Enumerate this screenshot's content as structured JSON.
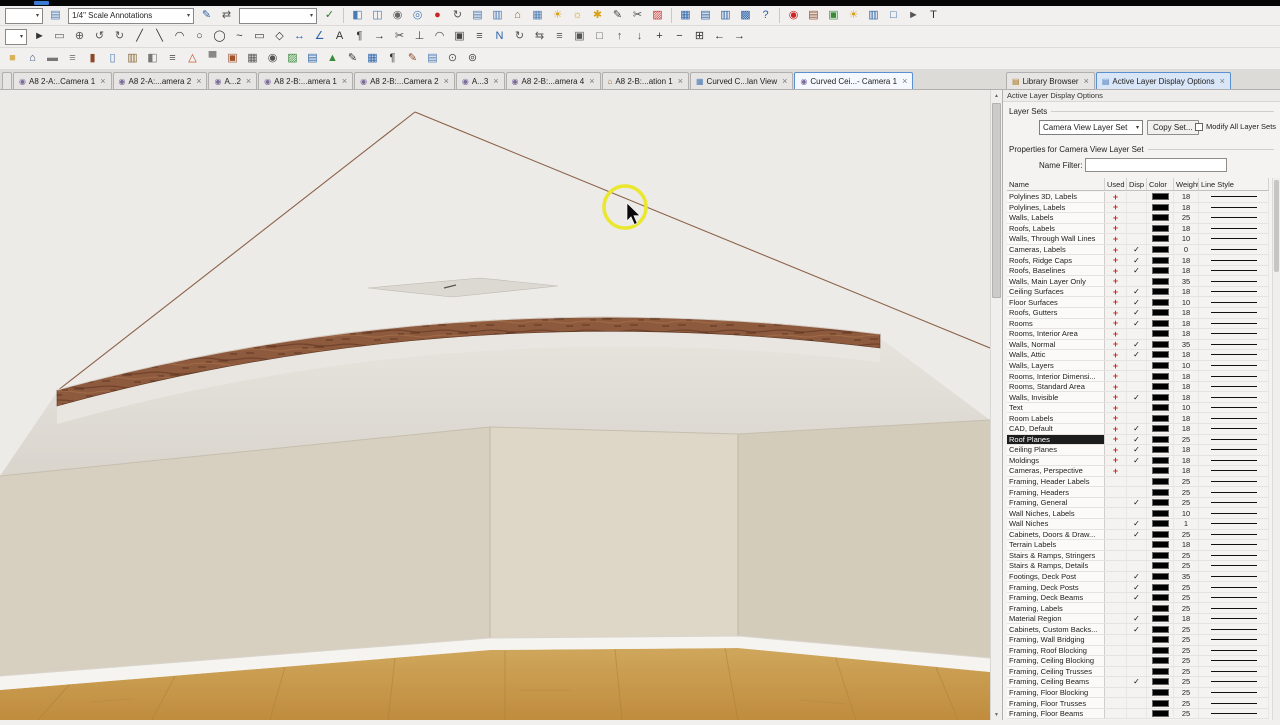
{
  "ui": {
    "close_glyph": "×",
    "combo_arrow": "▾",
    "check_glyph": "✓",
    "used_glyph": "+",
    "scroll_up": "▲",
    "scroll_down": "▼",
    "accent_chip": "#3a7bd5"
  },
  "toolbar_left": {
    "mini_combo": "",
    "scale_combo": "1/4\" Scale Annotations",
    "wide_combo": ""
  },
  "toolbar1pre1": [
    {
      "n": "layer-set-icon",
      "g": "▤",
      "c": "#4a7ab5"
    }
  ],
  "toolbar1pre2": [
    {
      "n": "annotation-pen-icon",
      "g": "✎",
      "c": "#2a62a8"
    },
    {
      "n": "swap-annotations-icon",
      "g": "⇄",
      "c": "#555555"
    }
  ],
  "toolbar1pre3": [
    {
      "n": "apply-check-icon",
      "g": "✓",
      "c": "#2a7a2a"
    }
  ],
  "toolbar1a": [
    {
      "n": "cube-3d-icon",
      "g": "◧",
      "c": "#4a7ab5"
    },
    {
      "n": "cube-faces-icon",
      "g": "◫",
      "c": "#4a7ab5"
    },
    {
      "n": "camera-view-icon",
      "g": "◉",
      "c": "#666666"
    },
    {
      "n": "orbit-view-icon",
      "g": "◎",
      "c": "#4a7ab5"
    },
    {
      "n": "record-walkthrough-icon",
      "g": "●",
      "c": "#cc2525"
    },
    {
      "n": "walkthrough-path-icon",
      "g": "↻",
      "c": "#555555"
    },
    {
      "n": "elevation-view-icon",
      "g": "▤",
      "c": "#4a7ab5"
    },
    {
      "n": "cross-section-icon",
      "g": "▥",
      "c": "#4a7ab5"
    },
    {
      "n": "backdrop-icon",
      "g": "⌂",
      "c": "#8a5a35"
    },
    {
      "n": "framing-overview-icon",
      "g": "▦",
      "c": "#4a7ab5"
    },
    {
      "n": "sun-settings-icon",
      "g": "☀",
      "c": "#d9a012"
    },
    {
      "n": "light-toggle-icon",
      "g": "☼",
      "c": "#d9a012"
    },
    {
      "n": "adjust-lights-icon",
      "g": "✱",
      "c": "#d9a012"
    },
    {
      "n": "edit-surface-icon",
      "g": "✎",
      "c": "#444444"
    },
    {
      "n": "delete-surface-icon",
      "g": "✂",
      "c": "#444444"
    },
    {
      "n": "hatch-fill-icon",
      "g": "▨",
      "c": "#cc3333"
    }
  ],
  "toolbar1b": [
    {
      "n": "layout-page-icon",
      "g": "▦",
      "c": "#2a62a8"
    },
    {
      "n": "layout-box-icon",
      "g": "▤",
      "c": "#2a62a8"
    },
    {
      "n": "schedule-table-icon",
      "g": "▥",
      "c": "#2a62a8"
    },
    {
      "n": "materials-list-icon",
      "g": "▩",
      "c": "#2a62a8"
    },
    {
      "n": "help-icon",
      "g": "?",
      "c": "#2a62a8"
    }
  ],
  "toolbar1c": [
    {
      "n": "render-camera-icon",
      "g": "◉",
      "c": "#cc2525"
    },
    {
      "n": "building-tools-icon",
      "g": "▤",
      "c": "#8a4a2a"
    },
    {
      "n": "picture-import-icon",
      "g": "▣",
      "c": "#3a8a3a"
    },
    {
      "n": "sun-angle-icon",
      "g": "☀",
      "c": "#d9a012"
    },
    {
      "n": "column-tool-icon",
      "g": "▥",
      "c": "#2a62a8"
    },
    {
      "n": "cad-detail-icon",
      "g": "□",
      "c": "#2a62a8"
    },
    {
      "n": "select-pointer-icon",
      "g": "►",
      "c": "#555555"
    },
    {
      "n": "text-tool-icon",
      "g": "T",
      "c": "#333333"
    }
  ],
  "toolbar2": [
    {
      "n": "select-arrow-icon",
      "g": "►",
      "c": "#333333"
    },
    {
      "n": "marquee-select-icon",
      "g": "▭",
      "c": "#555555"
    },
    {
      "n": "pan-icon",
      "g": "⊕",
      "c": "#555555"
    },
    {
      "n": "undo-icon",
      "g": "↺",
      "c": "#555555"
    },
    {
      "n": "redo-icon",
      "g": "↻",
      "c": "#555555"
    },
    {
      "n": "line-tool-icon",
      "g": "╱",
      "c": "#333333"
    },
    {
      "n": "polyline-tool-icon",
      "g": "╲",
      "c": "#333333"
    },
    {
      "n": "arc-tool-icon",
      "g": "◠",
      "c": "#333333"
    },
    {
      "n": "circle-tool-icon",
      "g": "○",
      "c": "#333333"
    },
    {
      "n": "oval-tool-icon",
      "g": "◯",
      "c": "#333333"
    },
    {
      "n": "spline-tool-icon",
      "g": "~",
      "c": "#333333"
    },
    {
      "n": "rectangle-tool-icon",
      "g": "▭",
      "c": "#333333"
    },
    {
      "n": "polygon-tool-icon",
      "g": "◇",
      "c": "#333333"
    },
    {
      "n": "dimension-tool-icon",
      "g": "↔",
      "c": "#2a62a8"
    },
    {
      "n": "angle-dimension-icon",
      "g": "∠",
      "c": "#2a62a8"
    },
    {
      "n": "text-icon",
      "g": "A",
      "c": "#333333"
    },
    {
      "n": "callout-icon",
      "g": "¶",
      "c": "#333333"
    },
    {
      "n": "arrow-tool-icon",
      "g": "→",
      "c": "#333333"
    },
    {
      "n": "break-tool-icon",
      "g": "✂",
      "c": "#444444"
    },
    {
      "n": "trim-tool-icon",
      "g": "⊥",
      "c": "#444444"
    },
    {
      "n": "fillet-tool-icon",
      "g": "◠",
      "c": "#444444"
    },
    {
      "n": "copy-icon",
      "g": "▣",
      "c": "#444444"
    },
    {
      "n": "measure-icon",
      "g": "≡",
      "c": "#444444"
    },
    {
      "n": "north-pointer-icon",
      "g": "N",
      "c": "#2a62a8"
    },
    {
      "n": "rotate-icon",
      "g": "↻",
      "c": "#555555"
    },
    {
      "n": "mirror-icon",
      "g": "⇆",
      "c": "#555555"
    },
    {
      "n": "align-icon",
      "g": "≡",
      "c": "#555555"
    },
    {
      "n": "group-icon",
      "g": "▣",
      "c": "#555555"
    },
    {
      "n": "ungroup-icon",
      "g": "□",
      "c": "#555555"
    },
    {
      "n": "raise-icon",
      "g": "↑",
      "c": "#555555"
    },
    {
      "n": "lower-icon",
      "g": "↓",
      "c": "#555555"
    },
    {
      "n": "zoom-in-icon",
      "g": "+",
      "c": "#333333"
    },
    {
      "n": "zoom-out-icon",
      "g": "−",
      "c": "#333333"
    },
    {
      "n": "fit-view-icon",
      "g": "⊞",
      "c": "#333333"
    },
    {
      "n": "previous-view-icon",
      "g": "←",
      "c": "#333333"
    },
    {
      "n": "next-view-icon",
      "g": "→",
      "c": "#333333"
    }
  ],
  "toolbar3": [
    {
      "n": "open-plan-icon",
      "g": "■",
      "c": "#d8b25a"
    },
    {
      "n": "home-icon",
      "g": "⌂",
      "c": "#35557a"
    },
    {
      "n": "wall-tool-icon",
      "g": "▬",
      "c": "#777777"
    },
    {
      "n": "railing-tool-icon",
      "g": "≡",
      "c": "#777777"
    },
    {
      "n": "door-tool-icon",
      "g": "▮",
      "c": "#8a4a2a"
    },
    {
      "n": "window-tool-icon",
      "g": "▯",
      "c": "#4a7ab5"
    },
    {
      "n": "cabinet-tool-icon",
      "g": "▥",
      "c": "#8a6a3a"
    },
    {
      "n": "fixture-tool-icon",
      "g": "◧",
      "c": "#777777"
    },
    {
      "n": "stairs-tool-icon",
      "g": "≡",
      "c": "#555555"
    },
    {
      "n": "roof-tool-icon",
      "g": "△",
      "c": "#c24a22"
    },
    {
      "n": "ceiling-tool-icon",
      "g": "▀",
      "c": "#888888"
    },
    {
      "n": "fireplace-tool-icon",
      "g": "▣",
      "c": "#a0522d"
    },
    {
      "n": "print-icon",
      "g": "▦",
      "c": "#555555"
    },
    {
      "n": "preview-icon",
      "g": "◉",
      "c": "#555555"
    },
    {
      "n": "material-painter-icon",
      "g": "▨",
      "c": "#3a8a3a"
    },
    {
      "n": "library-icon",
      "g": "▤",
      "c": "#2a62a8"
    },
    {
      "n": "terrain-icon",
      "g": "▲",
      "c": "#3a8a3a"
    },
    {
      "n": "cad-tools-icon",
      "g": "✎",
      "c": "#333333"
    },
    {
      "n": "schedule-icon",
      "g": "▦",
      "c": "#2a62a8"
    },
    {
      "n": "note-icon",
      "g": "¶",
      "c": "#333333"
    },
    {
      "n": "revision-icon",
      "g": "✎",
      "c": "#8a4a2a"
    },
    {
      "n": "layers-icon",
      "g": "▤",
      "c": "#4a7ab5"
    },
    {
      "n": "settings-icon",
      "g": "⊙",
      "c": "#555555"
    },
    {
      "n": "defaults-icon",
      "g": "⊚",
      "c": "#555555"
    }
  ],
  "doc_tabs": [
    {
      "label": "",
      "g": "",
      "gc": "#777777",
      "n": "tab-partial",
      "partial": true
    },
    {
      "label": "A8 2-A:..Camera 1",
      "g": "◉",
      "gc": "#7a6a9a",
      "n": "tab-a8-2a-camera-1"
    },
    {
      "label": "A8 2-A:...amera 2",
      "g": "◉",
      "gc": "#7a6a9a",
      "n": "tab-a8-2a-camera-2"
    },
    {
      "label": "A...2",
      "g": "◉",
      "gc": "#7a6a9a",
      "n": "tab-a-2"
    },
    {
      "label": "A8 2-B:...amera 1",
      "g": "◉",
      "gc": "#7a6a9a",
      "n": "tab-a8-2b-camera-1"
    },
    {
      "label": "A8 2-B:...Camera 2",
      "g": "◉",
      "gc": "#7a6a9a",
      "n": "tab-a8-2b-camera-2"
    },
    {
      "label": "A...3",
      "g": "◉",
      "gc": "#7a6a9a",
      "n": "tab-a-3"
    },
    {
      "label": "A8 2-B:...amera 4",
      "g": "◉",
      "gc": "#7a6a9a",
      "n": "tab-a8-2b-camera-4"
    },
    {
      "label": "A8 2-B:...ation 1",
      "g": "⌂",
      "gc": "#8a6a3a",
      "n": "tab-a8-2b-elevation-1"
    },
    {
      "label": "Curved C...lan View",
      "g": "▦",
      "gc": "#4a7ab5",
      "n": "tab-curved-ceiling-plan-view"
    },
    {
      "label": "Curved Cei...- Camera 1",
      "g": "◉",
      "gc": "#7a6a9a",
      "active": true,
      "n": "tab-curved-ceiling-camera-1"
    }
  ],
  "panel_tabs": [
    {
      "label": "Library Browser",
      "g": "▤",
      "gc": "#a8781e",
      "n": "tab-library-browser"
    },
    {
      "label": "Active Layer Display Options",
      "g": "▤",
      "gc": "#4a7ab5",
      "active": true,
      "n": "tab-active-layer-display-options"
    }
  ],
  "viewport": {
    "colors": {
      "ceiling": "#edebe7",
      "vault_top": "#e8e5e0",
      "vault_bottom": "#d9d5cd",
      "wall_left": "#d7cfbf",
      "wall_back": "#ded7c7",
      "wall_right": "#d3ccbb",
      "baseboard": "#f6f4f0",
      "floor_top": "#cfa75c",
      "floor_bottom": "#c08c3e",
      "beam_wood": "#8d5a3e",
      "ridge_line": "#8a6148",
      "highlight_ring": "#e9e72e"
    }
  },
  "panel": {
    "title": "Active Layer Display Options",
    "layer_sets_label": "Layer Sets",
    "layer_set_value": "Camera View Layer Set",
    "copy_set_button": "Copy Set...",
    "modify_all_label": "Modify All Layer Sets",
    "properties_label": "Properties for Camera View Layer Set",
    "name_filter_label": "Name Filter:",
    "name_filter_value": "",
    "columns": [
      "Name",
      "Used",
      "Disp",
      "Color",
      "Weight",
      "Line Style"
    ],
    "rows": [
      {
        "name": "Polylines 3D, Labels",
        "used": true,
        "disp": false,
        "weight": "18"
      },
      {
        "name": "Polylines, Labels",
        "used": true,
        "disp": false,
        "weight": "18"
      },
      {
        "name": "Walls, Labels",
        "used": true,
        "disp": false,
        "weight": "25"
      },
      {
        "name": "Roofs, Labels",
        "used": true,
        "disp": false,
        "weight": "18"
      },
      {
        "name": "Walls, Through Wall Lines",
        "used": true,
        "disp": false,
        "weight": "10"
      },
      {
        "name": "Cameras, Labels",
        "used": true,
        "disp": true,
        "weight": "0"
      },
      {
        "name": "Roofs, Ridge Caps",
        "used": true,
        "disp": true,
        "weight": "18"
      },
      {
        "name": "Roofs, Baselines",
        "used": true,
        "disp": true,
        "weight": "18"
      },
      {
        "name": "Walls, Main Layer Only",
        "used": true,
        "disp": false,
        "weight": "35"
      },
      {
        "name": "Ceiling Surfaces",
        "used": true,
        "disp": true,
        "weight": "18"
      },
      {
        "name": "Floor Surfaces",
        "used": true,
        "disp": true,
        "weight": "10"
      },
      {
        "name": "Roofs, Gutters",
        "used": true,
        "disp": true,
        "weight": "18"
      },
      {
        "name": "Rooms",
        "used": true,
        "disp": true,
        "weight": "18"
      },
      {
        "name": "Rooms, Interior Area",
        "used": true,
        "disp": false,
        "weight": "18"
      },
      {
        "name": "Walls, Normal",
        "used": true,
        "disp": true,
        "weight": "35"
      },
      {
        "name": "Walls, Attic",
        "used": true,
        "disp": true,
        "weight": "18"
      },
      {
        "name": "Walls, Layers",
        "used": true,
        "disp": false,
        "weight": "10"
      },
      {
        "name": "Rooms, Interior Dimensi...",
        "used": true,
        "disp": false,
        "weight": "18"
      },
      {
        "name": "Rooms, Standard Area",
        "used": true,
        "disp": false,
        "weight": "18"
      },
      {
        "name": "Walls, Invisible",
        "used": true,
        "disp": true,
        "weight": "18"
      },
      {
        "name": "Text",
        "used": true,
        "disp": false,
        "weight": "10"
      },
      {
        "name": "Room Labels",
        "used": true,
        "disp": false,
        "weight": "18"
      },
      {
        "name": "CAD, Default",
        "used": true,
        "disp": true,
        "weight": "18"
      },
      {
        "name": "Roof Planes",
        "used": true,
        "disp": true,
        "weight": "25",
        "selected": true
      },
      {
        "name": "Ceiling Planes",
        "used": true,
        "disp": true,
        "weight": "18"
      },
      {
        "name": "Moldings",
        "used": true,
        "disp": true,
        "weight": "18"
      },
      {
        "name": "Cameras, Perspective",
        "used": true,
        "disp": false,
        "weight": "18"
      },
      {
        "name": "Framing, Header Labels",
        "used": false,
        "disp": false,
        "weight": "25"
      },
      {
        "name": "Framing, Headers",
        "used": false,
        "disp": false,
        "weight": "25"
      },
      {
        "name": "Framing, General",
        "used": false,
        "disp": true,
        "weight": "25"
      },
      {
        "name": "Wall Niches, Labels",
        "used": false,
        "disp": false,
        "weight": "10"
      },
      {
        "name": "Wall Niches",
        "used": false,
        "disp": true,
        "weight": "1"
      },
      {
        "name": "Cabinets, Doors & Draw...",
        "used": false,
        "disp": true,
        "weight": "25"
      },
      {
        "name": "Terrain Labels",
        "used": false,
        "disp": false,
        "weight": "18"
      },
      {
        "name": "Stairs & Ramps, Stringers",
        "used": false,
        "disp": false,
        "weight": "25"
      },
      {
        "name": "Stairs & Ramps, Details",
        "used": false,
        "disp": false,
        "weight": "25"
      },
      {
        "name": "Footings, Deck Post",
        "used": false,
        "disp": true,
        "weight": "35"
      },
      {
        "name": "Framing, Deck Posts",
        "used": false,
        "disp": true,
        "weight": "25"
      },
      {
        "name": "Framing, Deck Beams",
        "used": false,
        "disp": true,
        "weight": "25"
      },
      {
        "name": "Framing, Labels",
        "used": false,
        "disp": false,
        "weight": "25"
      },
      {
        "name": "Material Region",
        "used": false,
        "disp": true,
        "weight": "18"
      },
      {
        "name": "Cabinets, Custom Backs...",
        "used": false,
        "disp": true,
        "weight": "25"
      },
      {
        "name": "Framing, Wall Bridging",
        "used": false,
        "disp": false,
        "weight": "25"
      },
      {
        "name": "Framing, Roof Blocking",
        "used": false,
        "disp": false,
        "weight": "25"
      },
      {
        "name": "Framing, Ceiling Blocking",
        "used": false,
        "disp": false,
        "weight": "25"
      },
      {
        "name": "Framing, Ceiling Trusses",
        "used": false,
        "disp": false,
        "weight": "25"
      },
      {
        "name": "Framing, Ceiling Beams",
        "used": false,
        "disp": true,
        "weight": "25"
      },
      {
        "name": "Framing, Floor Blocking",
        "used": false,
        "disp": false,
        "weight": "25"
      },
      {
        "name": "Framing, Floor Trusses",
        "used": false,
        "disp": false,
        "weight": "25"
      },
      {
        "name": "Framing, Floor Beams",
        "used": false,
        "disp": false,
        "weight": "25"
      }
    ]
  }
}
